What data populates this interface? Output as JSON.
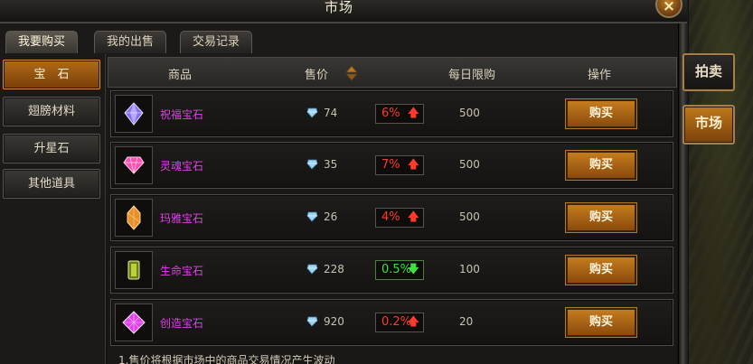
{
  "window": {
    "title": "市场",
    "close_glyph": "×"
  },
  "tabs": [
    {
      "label": "我要购买",
      "active": true
    },
    {
      "label": "我的出售",
      "active": false
    },
    {
      "label": "交易记录",
      "active": false
    }
  ],
  "sidebar": {
    "items": [
      {
        "label": "宝　石",
        "active": true
      },
      {
        "label": "翅膀材料",
        "active": false
      },
      {
        "label": "升星石",
        "active": false
      },
      {
        "label": "其他道具",
        "active": false
      }
    ]
  },
  "table": {
    "headers": {
      "item": "商品",
      "price": "售价",
      "limit": "每日限购",
      "action": "操作"
    },
    "rows": [
      {
        "name": "祝福宝石",
        "icon": "purple-gem-icon",
        "price": "74",
        "change": "6%",
        "direction": "up",
        "limit": "500",
        "buy": "购买"
      },
      {
        "name": "灵魂宝石",
        "icon": "pink-gem-icon",
        "price": "35",
        "change": "7%",
        "direction": "up",
        "limit": "500",
        "buy": "购买"
      },
      {
        "name": "玛雅宝石",
        "icon": "orange-gem-icon",
        "price": "26",
        "change": "4%",
        "direction": "up",
        "limit": "500",
        "buy": "购买"
      },
      {
        "name": "生命宝石",
        "icon": "green-gem-icon",
        "price": "228",
        "change": "0.5%",
        "direction": "down",
        "limit": "100",
        "buy": "购买"
      },
      {
        "name": "创造宝石",
        "icon": "magenta-gem-icon",
        "price": "920",
        "change": "0.2%",
        "direction": "up",
        "limit": "20",
        "buy": "购买"
      }
    ]
  },
  "footer": {
    "note": "1.售价将根据市场中的商品交易情况产生波动"
  },
  "right_tabs": {
    "auction": "拍卖",
    "market": "市场"
  },
  "colors": {
    "accent": "#c57c1e",
    "item_name": "#e040e8",
    "price_up": "#ff3a2a",
    "price_down": "#3ee03e"
  }
}
